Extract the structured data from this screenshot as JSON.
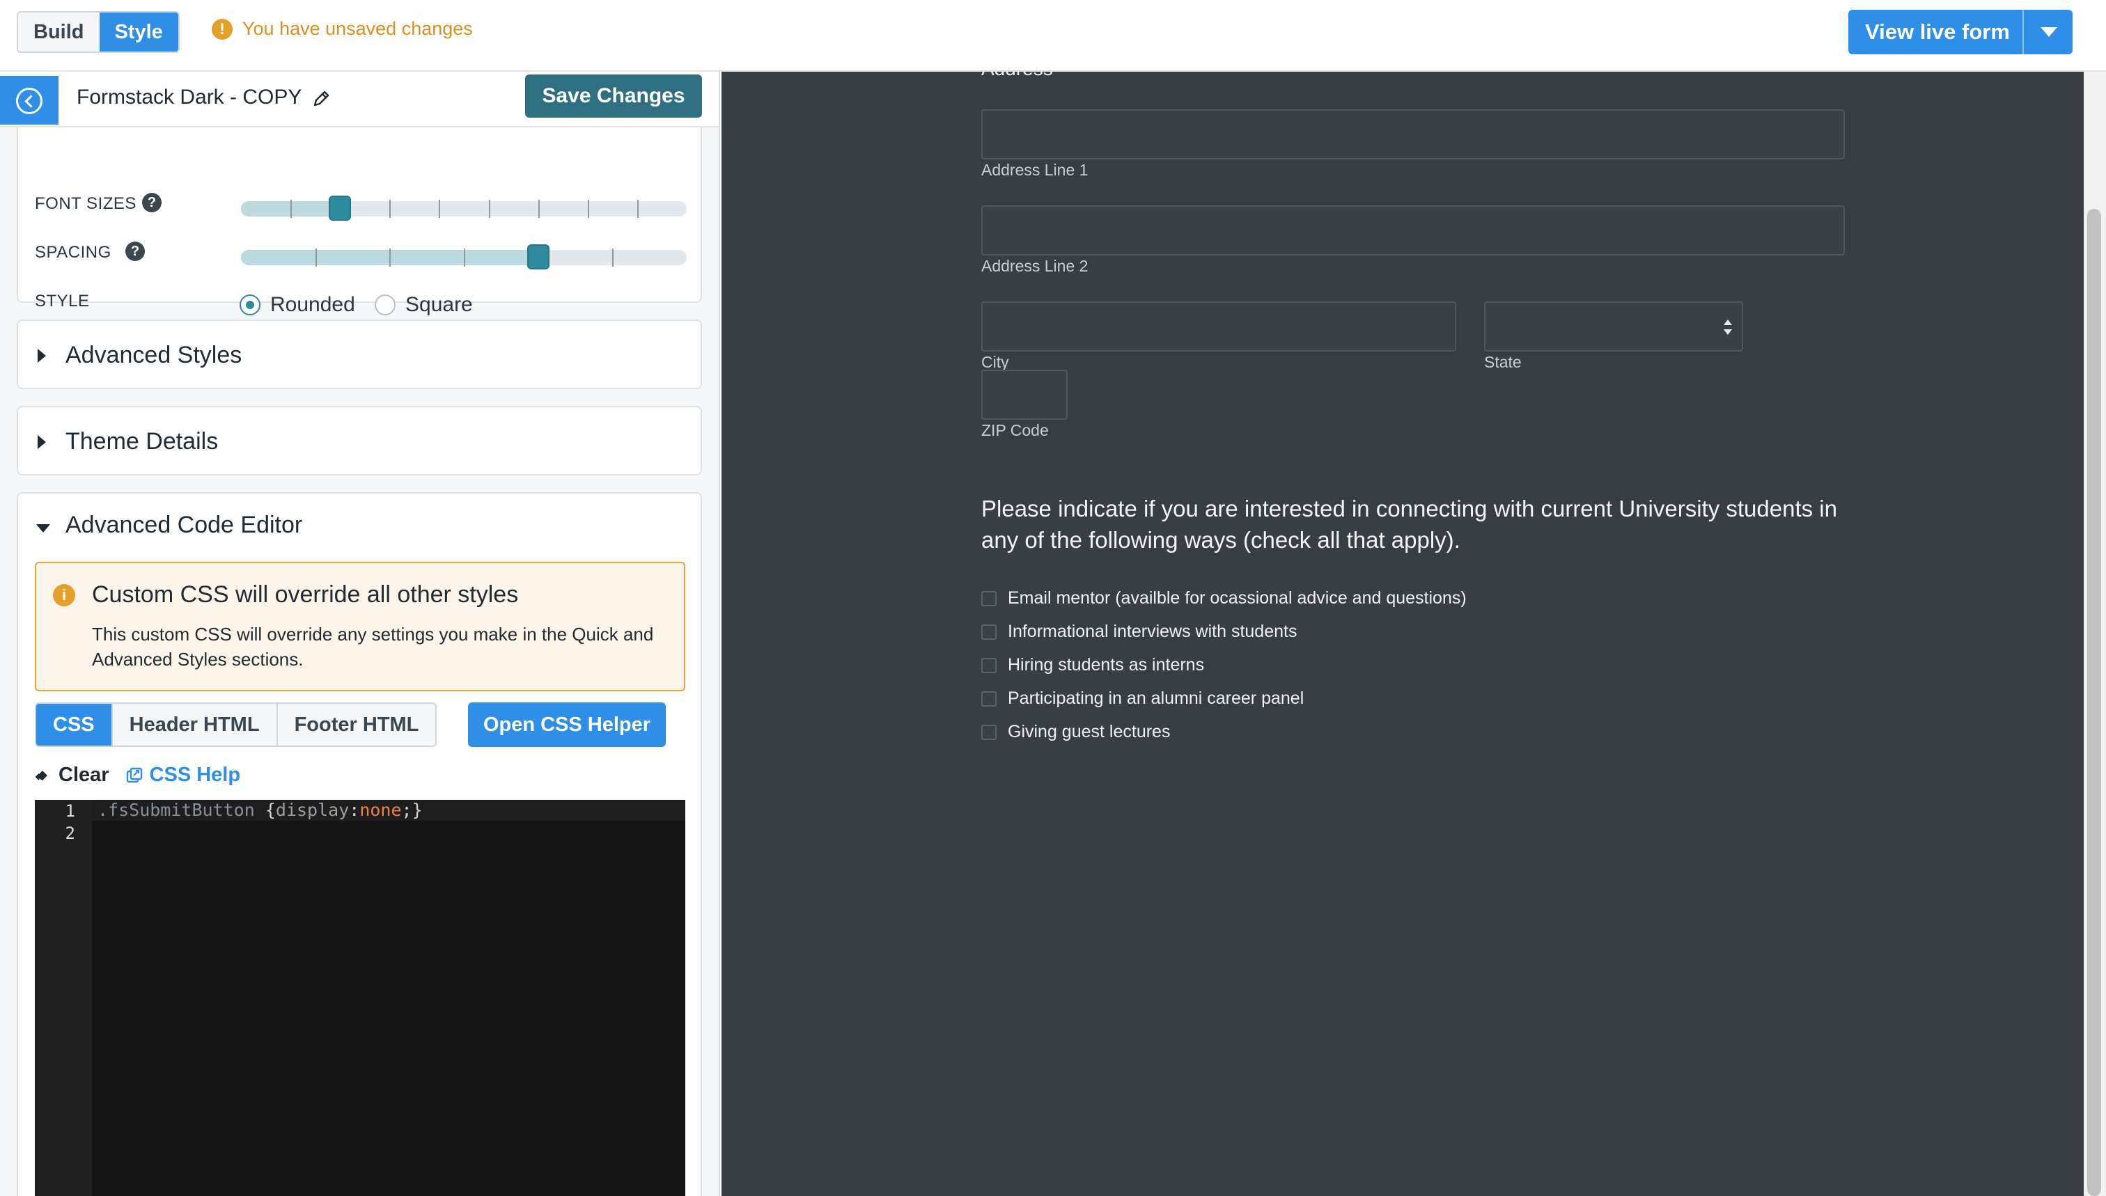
{
  "topbar": {
    "tabs": [
      {
        "label": "Build"
      },
      {
        "label": "Style"
      }
    ],
    "unsaved_text": "You have unsaved changes",
    "view_live_label": "View live form"
  },
  "theme": {
    "name": "Formstack Dark - COPY",
    "save_label": "Save Changes"
  },
  "quick_styles": {
    "font_sizes_label": "FONT SIZES",
    "font_sizes_level": 2,
    "font_sizes_steps": 9,
    "spacing_label": "SPACING",
    "spacing_level": 4,
    "spacing_steps": 6,
    "style_label": "STYLE",
    "style_options": [
      {
        "label": "Rounded",
        "checked": true
      },
      {
        "label": "Square",
        "checked": false
      }
    ]
  },
  "sections": {
    "advanced_styles": "Advanced Styles",
    "theme_details": "Theme Details",
    "advanced_code_editor": "Advanced Code Editor"
  },
  "alert": {
    "title": "Custom CSS will override all other styles",
    "body": "This custom CSS will override any settings you make in the Quick and Advanced Styles sections."
  },
  "code_tabs": [
    {
      "label": "CSS",
      "active": true
    },
    {
      "label": "Header HTML",
      "active": false
    },
    {
      "label": "Footer HTML",
      "active": false
    }
  ],
  "css_helper_label": "Open CSS Helper",
  "tools": {
    "clear": "Clear",
    "help": "CSS Help"
  },
  "editor": {
    "line_numbers": [
      "1",
      "2"
    ],
    "line1": {
      "selector": ".fsSubmitButton",
      "open": " {",
      "prop": "display",
      "colon": ":",
      "value": "none",
      "close": ";}"
    }
  },
  "preview": {
    "address_label": "Address",
    "address_line1": "Address Line 1",
    "address_line2": "Address Line 2",
    "city": "City",
    "state": "State",
    "zip": "ZIP Code",
    "question": "Please indicate if you are interested in connecting with current University students in any of the following ways (check all that apply).",
    "options": [
      "Email mentor (availble for ocassional advice and questions)",
      "Informational interviews with students",
      "Hiring students as interns",
      "Participating in an alumni career panel",
      "Giving guest lectures"
    ]
  },
  "colors": {
    "accent": "#2f8ee6",
    "save": "#2f6f82",
    "slider": "#2f8ba0",
    "warning": "#e3a02b",
    "preview_bg": "#373e44"
  }
}
